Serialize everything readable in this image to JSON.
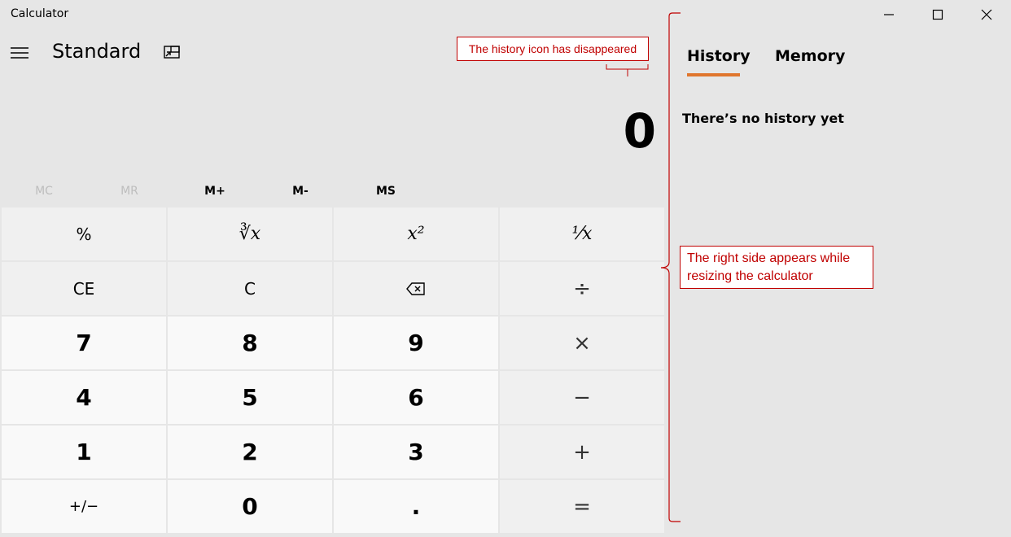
{
  "window": {
    "title": "Calculator",
    "controls": {
      "minimize": "minimize",
      "maximize": "maximize",
      "close": "close"
    }
  },
  "header": {
    "mode": "Standard",
    "menu_icon": "hamburger-menu-icon",
    "keep_on_top_icon": "keep-on-top-icon"
  },
  "display": {
    "value": "0"
  },
  "memory": {
    "buttons": [
      "MC",
      "MR",
      "M+",
      "M-",
      "MS"
    ],
    "disabled": [
      "MC",
      "MR"
    ]
  },
  "keys": [
    [
      "%",
      "∛x",
      "x²",
      "⅟x"
    ],
    [
      "CE",
      "C",
      "⌫",
      "÷"
    ],
    [
      "7",
      "8",
      "9",
      "×"
    ],
    [
      "4",
      "5",
      "6",
      "−"
    ],
    [
      "1",
      "2",
      "3",
      "+"
    ],
    [
      "+/−",
      "0",
      ".",
      "="
    ]
  ],
  "side_panel": {
    "tabs": [
      "History",
      "Memory"
    ],
    "active_tab": "History",
    "empty_message": "There’s no history yet"
  },
  "annotations": {
    "history_icon_note": "The history icon has disappeared",
    "right_side_note_line1": "The right side appears while",
    "right_side_note_line2": "resizing the calculator"
  },
  "colors": {
    "background": "#e6e6e6",
    "accent": "#e0762d",
    "annotation": "#c00000"
  }
}
